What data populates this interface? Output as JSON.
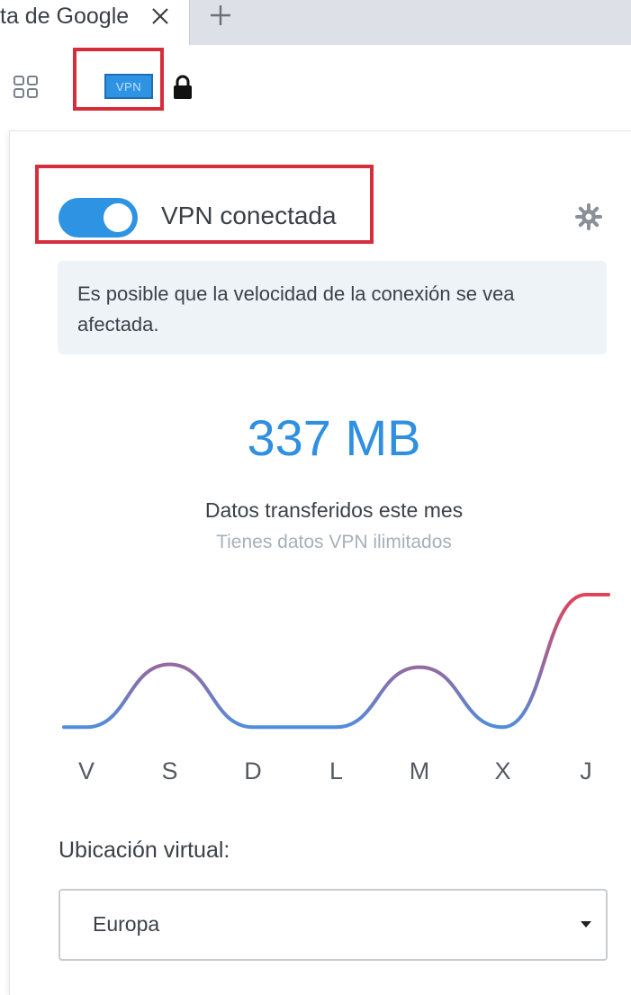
{
  "browser": {
    "tab_title": "ta de Google",
    "new_tab_glyph": "+",
    "vpn_badge_label": "VPN"
  },
  "popup": {
    "vpn_status": "VPN conectada",
    "vpn_enabled": true,
    "notice": "Es posible que la velocidad de la conexión se vea afectada.",
    "data_amount": "337 MB",
    "data_label": "Datos transferidos este mes",
    "data_sub": "Tienes datos VPN ilimitados",
    "location_label": "Ubicación virtual:",
    "location_value": "Europa"
  },
  "chart_data": {
    "type": "line",
    "categories": [
      "V",
      "S",
      "D",
      "L",
      "M",
      "X",
      "J"
    ],
    "values": [
      0.05,
      0.5,
      0.05,
      0.05,
      0.48,
      0.05,
      1.0
    ],
    "colors": {
      "low": "#4a90e2",
      "high": "#e0435a"
    }
  },
  "colors": {
    "accent": "#2f93e4",
    "highlight_box": "#d62d3a"
  },
  "icons": [
    "close-icon",
    "plus-icon",
    "grid-icon",
    "lock-icon",
    "gear-icon",
    "chevron-down-icon"
  ]
}
